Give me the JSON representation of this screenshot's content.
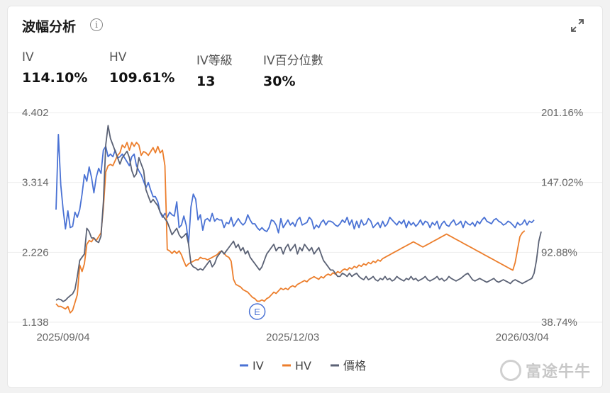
{
  "title": "波幅分析",
  "stats": [
    {
      "label": "IV",
      "value": "114.10%"
    },
    {
      "label": "HV",
      "value": "109.61%"
    },
    {
      "label": "IV等級",
      "value": "13"
    },
    {
      "label": "IV百分位數",
      "value": "30%"
    }
  ],
  "watermark": "富途牛牛",
  "colors": {
    "iv": "#4a72d4",
    "hv": "#ec7e2c",
    "price": "#5b6275",
    "grid": "#eeeeee",
    "event": "#4a72d4"
  },
  "chart_data": {
    "type": "line",
    "left_axis_ticks": [
      "4.402",
      "3.314",
      "2.226",
      "1.138"
    ],
    "right_axis_ticks": [
      "201.16%",
      "147.02%",
      "92.88%",
      "38.74%"
    ],
    "left_axis_range": [
      1.138,
      4.402
    ],
    "right_axis_range": [
      38.74,
      201.16
    ],
    "x_labels": [
      "2025/09/04",
      "2025/12/03",
      "2026/03/04"
    ],
    "x_label_index": [
      3,
      100,
      197
    ],
    "event_marker": {
      "label": "E",
      "index": 85
    },
    "legend": [
      "IV",
      "HV",
      "價格"
    ],
    "series": [
      {
        "name": "IV",
        "axis": "right",
        "values": [
          126.0,
          184.2,
          145.0,
          126.0,
          111.0,
          125.0,
          112.0,
          113.0,
          124.0,
          120.0,
          126.0,
          138.0,
          153.0,
          148.0,
          159.0,
          151.0,
          139.0,
          151.0,
          158.0,
          154.0,
          172.0,
          175.0,
          167.0,
          169.0,
          167.0,
          172.0,
          166.0,
          167.0,
          169.0,
          166.0,
          163.0,
          160.0,
          167.0,
          169.0,
          160.0,
          156.0,
          153.0,
          148.0,
          143.0,
          147.0,
          141.0,
          136.0,
          136.0,
          132.0,
          124.0,
          120.0,
          123.0,
          120.0,
          124.0,
          122.0,
          121.0,
          132.0,
          112.0,
          114.0,
          121.0,
          114.0,
          100.0,
          128.0,
          138.0,
          134.0,
          118.0,
          122.0,
          110.0,
          118.0,
          119.0,
          117.0,
          123.0,
          117.0,
          119.0,
          118.0,
          118.0,
          112.0,
          116.0,
          115.0,
          120.0,
          113.0,
          116.0,
          119.0,
          116.0,
          114.0,
          116.0,
          122.0,
          118.0,
          115.0,
          115.0,
          112.0,
          110.0,
          112.0,
          110.0,
          109.0,
          112.0,
          118.0,
          117.0,
          114.0,
          108.0,
          119.0,
          112.0,
          115.0,
          118.0,
          114.0,
          116.0,
          113.0,
          118.0,
          120.0,
          114.0,
          115.0,
          116.0,
          120.0,
          118.0,
          111.0,
          114.0,
          112.0,
          116.0,
          118.0,
          114.0,
          117.0,
          117.0,
          116.0,
          114.0,
          113.0,
          115.0,
          118.0,
          116.0,
          120.0,
          114.0,
          118.0,
          111.0,
          117.0,
          112.0,
          118.0,
          114.0,
          115.0,
          119.0,
          117.0,
          112.0,
          114.0,
          116.0,
          112.0,
          117.0,
          113.0,
          115.0,
          120.0,
          118.0,
          116.0,
          114.0,
          117.0,
          115.0,
          118.0,
          112.0,
          117.0,
          114.0,
          116.0,
          113.0,
          115.0,
          118.0,
          114.0,
          117.0,
          116.0,
          112.0,
          116.0,
          114.0,
          117.0,
          111.0,
          115.0,
          117.0,
          114.0,
          113.0,
          116.0,
          118.0,
          114.0,
          115.0,
          117.0,
          112.0,
          117.0,
          115.0,
          114.0,
          116.0,
          113.0,
          117.0,
          115.0,
          118.0,
          120.0,
          117.0,
          116.0,
          115.0,
          118.0,
          119.0,
          117.0,
          116.0,
          114.0,
          115.0,
          117.0,
          116.0,
          114.0,
          112.0,
          116.0,
          114.0,
          115.0,
          118.0,
          114.0,
          117.0,
          116.0,
          118.0
        ]
      },
      {
        "name": "HV",
        "axis": "right",
        "values": [
          53.0,
          51.0,
          51.0,
          50.0,
          49.0,
          51.0,
          46.0,
          48.0,
          54.0,
          60.0,
          83.0,
          78.0,
          84.0,
          99.0,
          102.0,
          101.0,
          104.0,
          102.0,
          105.0,
          108.0,
          127.0,
          155.0,
          160.0,
          161.0,
          160.0,
          164.0,
          168.0,
          170.0,
          176.0,
          174.0,
          178.0,
          172.0,
          178.0,
          175.0,
          178.0,
          176.0,
          168.0,
          171.0,
          170.0,
          168.0,
          171.0,
          174.0,
          170.0,
          175.0,
          170.0,
          172.0,
          160.0,
          95.0,
          94.0,
          92.0,
          94.0,
          92.0,
          94.0,
          91.0,
          86.0,
          82.0,
          84.0,
          85.0,
          86.0,
          87.0,
          87.0,
          89.0,
          88.0,
          88.0,
          87.0,
          88.0,
          89.0,
          90.0,
          91.0,
          93.0,
          94.0,
          92.0,
          90.0,
          89.0,
          86.0,
          72.0,
          68.0,
          67.0,
          66.0,
          64.0,
          63.0,
          62.0,
          60.0,
          58.0,
          57.0,
          55.0,
          55.0,
          56.0,
          55.0,
          57.0,
          58.0,
          60.0,
          62.0,
          61.0,
          63.0,
          65.0,
          64.0,
          65.0,
          64.0,
          66.0,
          67.0,
          66.0,
          68.0,
          69.0,
          70.0,
          71.0,
          70.0,
          72.0,
          73.0,
          74.0,
          73.0,
          72.0,
          74.0,
          73.0,
          75.0,
          76.0,
          75.0,
          77.0,
          76.0,
          78.0,
          77.0,
          79.0,
          80.0,
          79.0,
          81.0,
          80.0,
          82.0,
          81.0,
          83.0,
          82.0,
          84.0,
          83.0,
          85.0,
          84.0,
          86.0,
          85.0,
          87.0,
          86.0,
          88.0,
          89.0,
          90.0,
          91.0,
          92.0,
          93.0,
          94.0,
          95.0,
          96.0,
          97.0,
          98.0,
          99.0,
          100.0,
          101.0,
          100.0,
          99.0,
          98.0,
          97.0,
          98.0,
          99.0,
          100.0,
          101.0,
          102.0,
          103.0,
          104.0,
          105.0,
          106.0,
          107.0,
          106.0,
          105.0,
          104.0,
          103.0,
          102.0,
          101.0,
          100.0,
          99.0,
          98.0,
          97.0,
          96.0,
          95.0,
          94.0,
          93.0,
          92.0,
          91.0,
          90.0,
          89.0,
          88.0,
          87.0,
          86.0,
          85.0,
          84.0,
          83.0,
          82.0,
          81.0,
          80.0,
          79.0,
          85.0,
          95.0,
          105.0,
          108.0,
          109.61
        ]
      },
      {
        "name": "價格",
        "axis": "left",
        "values": [
          1.48,
          1.5,
          1.49,
          1.46,
          1.48,
          1.52,
          1.55,
          1.58,
          1.65,
          1.85,
          2.1,
          2.15,
          2.2,
          2.6,
          2.55,
          2.45,
          2.45,
          2.4,
          2.38,
          2.48,
          3.0,
          3.9,
          4.2,
          4.0,
          3.9,
          3.8,
          3.7,
          3.6,
          3.7,
          3.75,
          3.8,
          3.7,
          3.5,
          3.4,
          3.45,
          3.7,
          3.6,
          3.5,
          3.2,
          3.1,
          3.0,
          3.05,
          3.0,
          2.95,
          2.85,
          2.8,
          2.75,
          2.7,
          2.6,
          2.5,
          2.55,
          2.6,
          2.5,
          2.45,
          2.48,
          2.52,
          2.35,
          2.05,
          2.0,
          1.98,
          1.95,
          1.97,
          1.95,
          2.0,
          2.05,
          2.1,
          2.0,
          2.05,
          2.15,
          2.2,
          2.25,
          2.2,
          2.25,
          2.3,
          2.35,
          2.4,
          2.3,
          2.35,
          2.25,
          2.3,
          2.2,
          2.25,
          2.15,
          2.1,
          2.05,
          2.0,
          1.95,
          2.0,
          2.1,
          2.2,
          2.25,
          2.3,
          2.35,
          2.25,
          2.3,
          2.3,
          2.2,
          2.3,
          2.35,
          2.25,
          2.3,
          2.35,
          2.2,
          2.3,
          2.25,
          2.35,
          2.3,
          2.25,
          2.3,
          2.2,
          2.25,
          2.3,
          2.2,
          2.1,
          2.05,
          2.0,
          1.95,
          1.95,
          1.9,
          1.85,
          1.85,
          1.9,
          1.88,
          1.85,
          1.9,
          1.85,
          1.88,
          1.9,
          1.85,
          1.82,
          1.8,
          1.85,
          1.8,
          1.82,
          1.85,
          1.8,
          1.78,
          1.82,
          1.8,
          1.85,
          1.8,
          1.82,
          1.78,
          1.8,
          1.85,
          1.82,
          1.8,
          1.78,
          1.82,
          1.8,
          1.85,
          1.8,
          1.82,
          1.78,
          1.8,
          1.82,
          1.85,
          1.8,
          1.78,
          1.8,
          1.82,
          1.85,
          1.8,
          1.82,
          1.78,
          1.8,
          1.85,
          1.82,
          1.8,
          1.78,
          1.8,
          1.82,
          1.85,
          1.88,
          1.9,
          1.85,
          1.8,
          1.78,
          1.8,
          1.82,
          1.8,
          1.78,
          1.76,
          1.78,
          1.8,
          1.82,
          1.78,
          1.76,
          1.78,
          1.8,
          1.78,
          1.76,
          1.74,
          1.78,
          1.8,
          1.78,
          1.76,
          1.74,
          1.76,
          1.78,
          1.8,
          1.82,
          1.9,
          2.1,
          2.4,
          2.55
        ]
      }
    ]
  }
}
